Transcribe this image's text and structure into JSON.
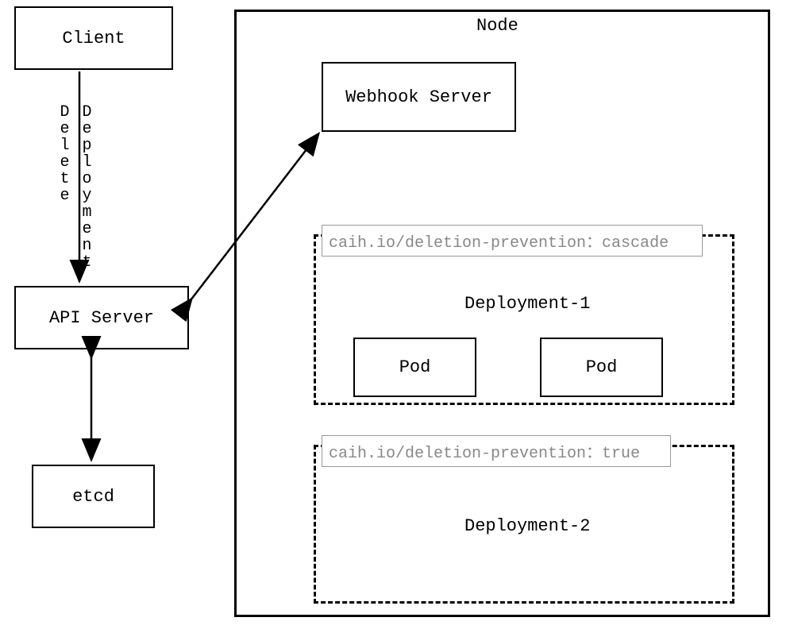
{
  "client": {
    "label": "Client"
  },
  "api_server": {
    "label": "API Server"
  },
  "etcd": {
    "label": "etcd"
  },
  "node": {
    "title": "Node"
  },
  "webhook": {
    "label": "Webhook Server"
  },
  "deploy1": {
    "annotation": "caih.io/deletion-prevention：cascade",
    "name": "Deployment-1",
    "pod1": "Pod",
    "pod2": "Pod"
  },
  "deploy2": {
    "annotation": "caih.io/deletion-prevention：true",
    "name": "Deployment-2"
  },
  "edges": {
    "delete": "Delete",
    "deployment": "Deployment"
  }
}
